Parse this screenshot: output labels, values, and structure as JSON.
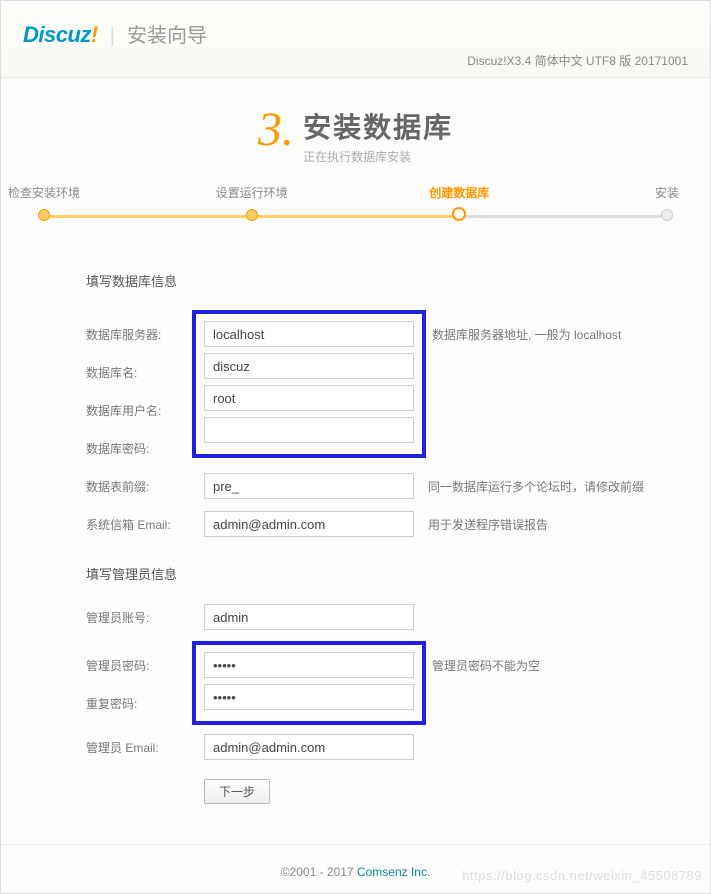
{
  "header": {
    "logo_text": "Discuz",
    "logo_excl": "!",
    "title": "安装向导",
    "version": "Discuz!X3.4 简体中文 UTF8 版 20171001"
  },
  "step": {
    "number": "3.",
    "title": "安装数据库",
    "subtitle": "正在执行数据库安装"
  },
  "progress": {
    "steps": [
      "检查安装环境",
      "设置运行环境",
      "创建数据库",
      "安装"
    ],
    "active_index": 2
  },
  "sections": {
    "db_title": "填写数据库信息",
    "admin_title": "填写管理员信息"
  },
  "db": {
    "host_label": "数据库服务器:",
    "host_value": "localhost",
    "host_hint": "数据库服务器地址, 一般为 localhost",
    "name_label": "数据库名:",
    "name_value": "discuz",
    "user_label": "数据库用户名:",
    "user_value": "root",
    "pass_label": "数据库密码:",
    "pass_value": "",
    "prefix_label": "数据表前缀:",
    "prefix_value": "pre_",
    "prefix_hint": "同一数据库运行多个论坛时，请修改前缀",
    "email_label": "系统信箱 Email:",
    "email_value": "admin@admin.com",
    "email_hint": "用于发送程序错误报告"
  },
  "admin": {
    "user_label": "管理员账号:",
    "user_value": "admin",
    "pass_label": "管理员密码:",
    "pass_value": "•••••",
    "pass_hint": "管理员密码不能为空",
    "pass2_label": "重复密码:",
    "pass2_value": "•••••",
    "email_label": "管理员 Email:",
    "email_value": "admin@admin.com"
  },
  "button": {
    "next": "下一步"
  },
  "footer": {
    "copyright": "©2001 - 2017 ",
    "company": "Comsenz Inc.",
    "watermark": "https://blog.csdn.net/weixin_45508789"
  }
}
